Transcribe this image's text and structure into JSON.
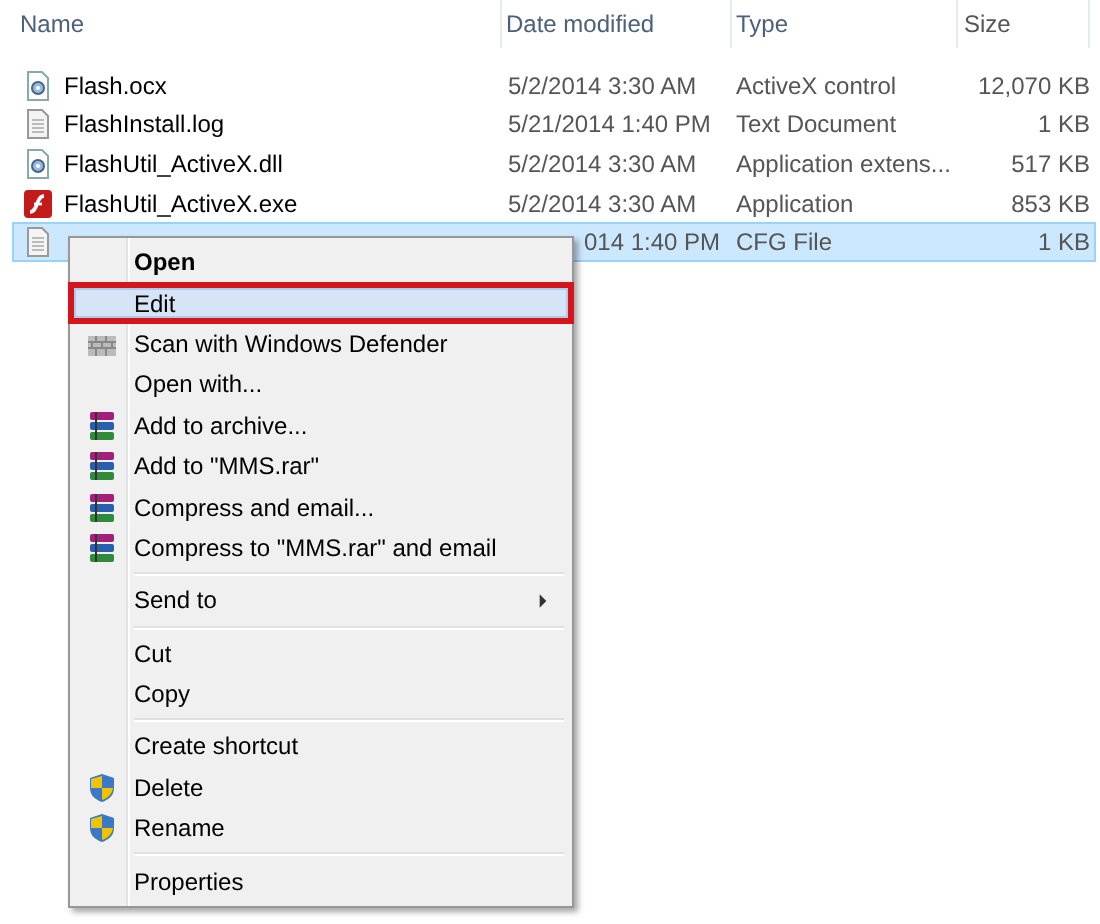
{
  "columns": [
    "Name",
    "Date modified",
    "Type",
    "Size"
  ],
  "files": [
    {
      "kind": "activex",
      "name": "Flash.ocx",
      "date": "5/2/2014 3:30 AM",
      "type": "ActiveX control",
      "size": "12,070 KB",
      "selected": false
    },
    {
      "kind": "text",
      "name": "FlashInstall.log",
      "date": "5/21/2014 1:40 PM",
      "type": "Text Document",
      "size": "1 KB",
      "selected": false
    },
    {
      "kind": "activex",
      "name": "FlashUtil_ActiveX.dll",
      "date": "5/2/2014 3:30 AM",
      "type": "Application extens...",
      "size": "517 KB",
      "selected": false
    },
    {
      "kind": "flash",
      "name": "FlashUtil_ActiveX.exe",
      "date": "5/2/2014 3:30 AM",
      "type": "Application",
      "size": "853 KB",
      "selected": false
    },
    {
      "kind": "text",
      "date": "014 1:40 PM",
      "type": "CFG File",
      "size": "1 KB",
      "selected": true
    }
  ],
  "context_menu": {
    "groups": [
      [
        {
          "label": "Open",
          "bold": true,
          "selected": false
        },
        {
          "label": "Edit",
          "selected": true,
          "highlighted": true
        },
        {
          "label": "Scan with Windows Defender",
          "kind": "defender",
          "selected": false
        },
        {
          "label": "Open with...",
          "selected": false
        },
        {
          "label": "Add to archive...",
          "kind": "archiver",
          "selected": false
        },
        {
          "label": "Add to \"MMS.rar\"",
          "kind": "archiver",
          "selected": false
        },
        {
          "label": "Compress and email...",
          "kind": "archiver",
          "selected": false
        },
        {
          "label": "Compress to \"MMS.rar\" and email",
          "kind": "archiver",
          "selected": false
        }
      ],
      [
        {
          "label": "Send to",
          "submenu": true,
          "selected": false
        }
      ],
      [
        {
          "label": "Cut",
          "selected": false
        },
        {
          "label": "Copy",
          "selected": false
        }
      ],
      [
        {
          "label": "Create shortcut",
          "selected": false
        },
        {
          "label": "Delete",
          "kind": "shield",
          "selected": false
        },
        {
          "label": "Rename",
          "kind": "shield",
          "selected": false
        }
      ],
      [
        {
          "label": "Properties",
          "selected": false
        }
      ]
    ]
  }
}
